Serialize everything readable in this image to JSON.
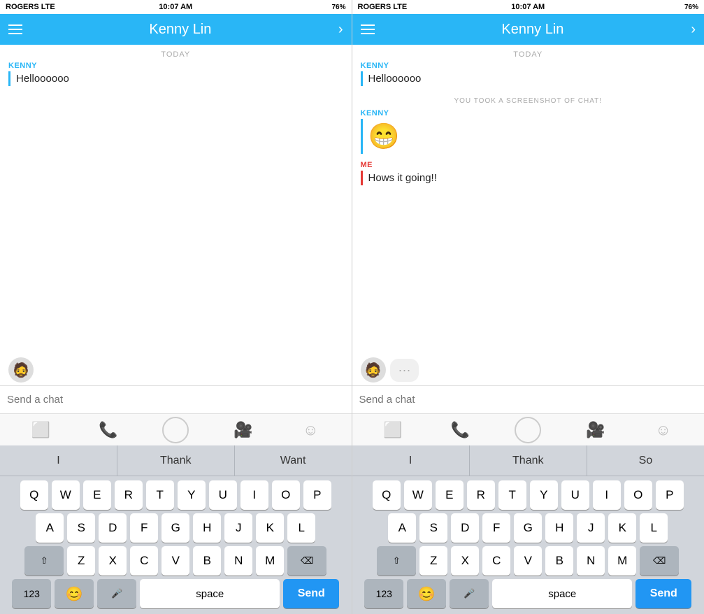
{
  "panels": [
    {
      "id": "left",
      "statusBar": {
        "carrier": "ROGERS  LTE",
        "time": "10:07 AM",
        "battery": "76%"
      },
      "navTitle": "Kenny Lin",
      "dateSep": "TODAY",
      "messages": [
        {
          "sender": "KENNY",
          "senderType": "other",
          "text": "Helloooooo",
          "type": "text"
        }
      ],
      "avatar": true,
      "inputPlaceholder": "Send a chat",
      "autocomplete": [
        "I",
        "Thank",
        "Want"
      ],
      "keyboard": {
        "rows": [
          [
            "Q",
            "W",
            "E",
            "R",
            "T",
            "Y",
            "U",
            "I",
            "O",
            "P"
          ],
          [
            "A",
            "S",
            "D",
            "F",
            "G",
            "H",
            "J",
            "K",
            "L"
          ],
          [
            "⇧",
            "Z",
            "X",
            "C",
            "V",
            "B",
            "N",
            "M",
            "⌫"
          ],
          [
            "123",
            "😊",
            "🎤",
            "space",
            "Send"
          ]
        ]
      }
    },
    {
      "id": "right",
      "statusBar": {
        "carrier": "ROGERS  LTE",
        "time": "10:07 AM",
        "battery": "76%"
      },
      "navTitle": "Kenny Lin",
      "dateSep": "TODAY",
      "messages": [
        {
          "sender": "KENNY",
          "senderType": "other",
          "text": "Helloooooo",
          "type": "text"
        },
        {
          "type": "screenshot_notice",
          "text": "YOU TOOK A SCREENSHOT OF CHAT!"
        },
        {
          "sender": "KENNY",
          "senderType": "other",
          "text": "😁",
          "type": "emoji"
        },
        {
          "sender": "ME",
          "senderType": "me",
          "text": "Hows it going!!",
          "type": "text"
        }
      ],
      "avatar": true,
      "inputPlaceholder": "Send a chat",
      "autocomplete": [
        "I",
        "Thank",
        "So"
      ],
      "keyboard": {
        "rows": [
          [
            "Q",
            "W",
            "E",
            "R",
            "T",
            "Y",
            "U",
            "I",
            "O",
            "P"
          ],
          [
            "A",
            "S",
            "D",
            "F",
            "G",
            "H",
            "J",
            "K",
            "L"
          ],
          [
            "⇧",
            "Z",
            "X",
            "C",
            "V",
            "B",
            "N",
            "M",
            "⌫"
          ],
          [
            "123",
            "😊",
            "🎤",
            "space",
            "Send"
          ]
        ]
      }
    }
  ]
}
